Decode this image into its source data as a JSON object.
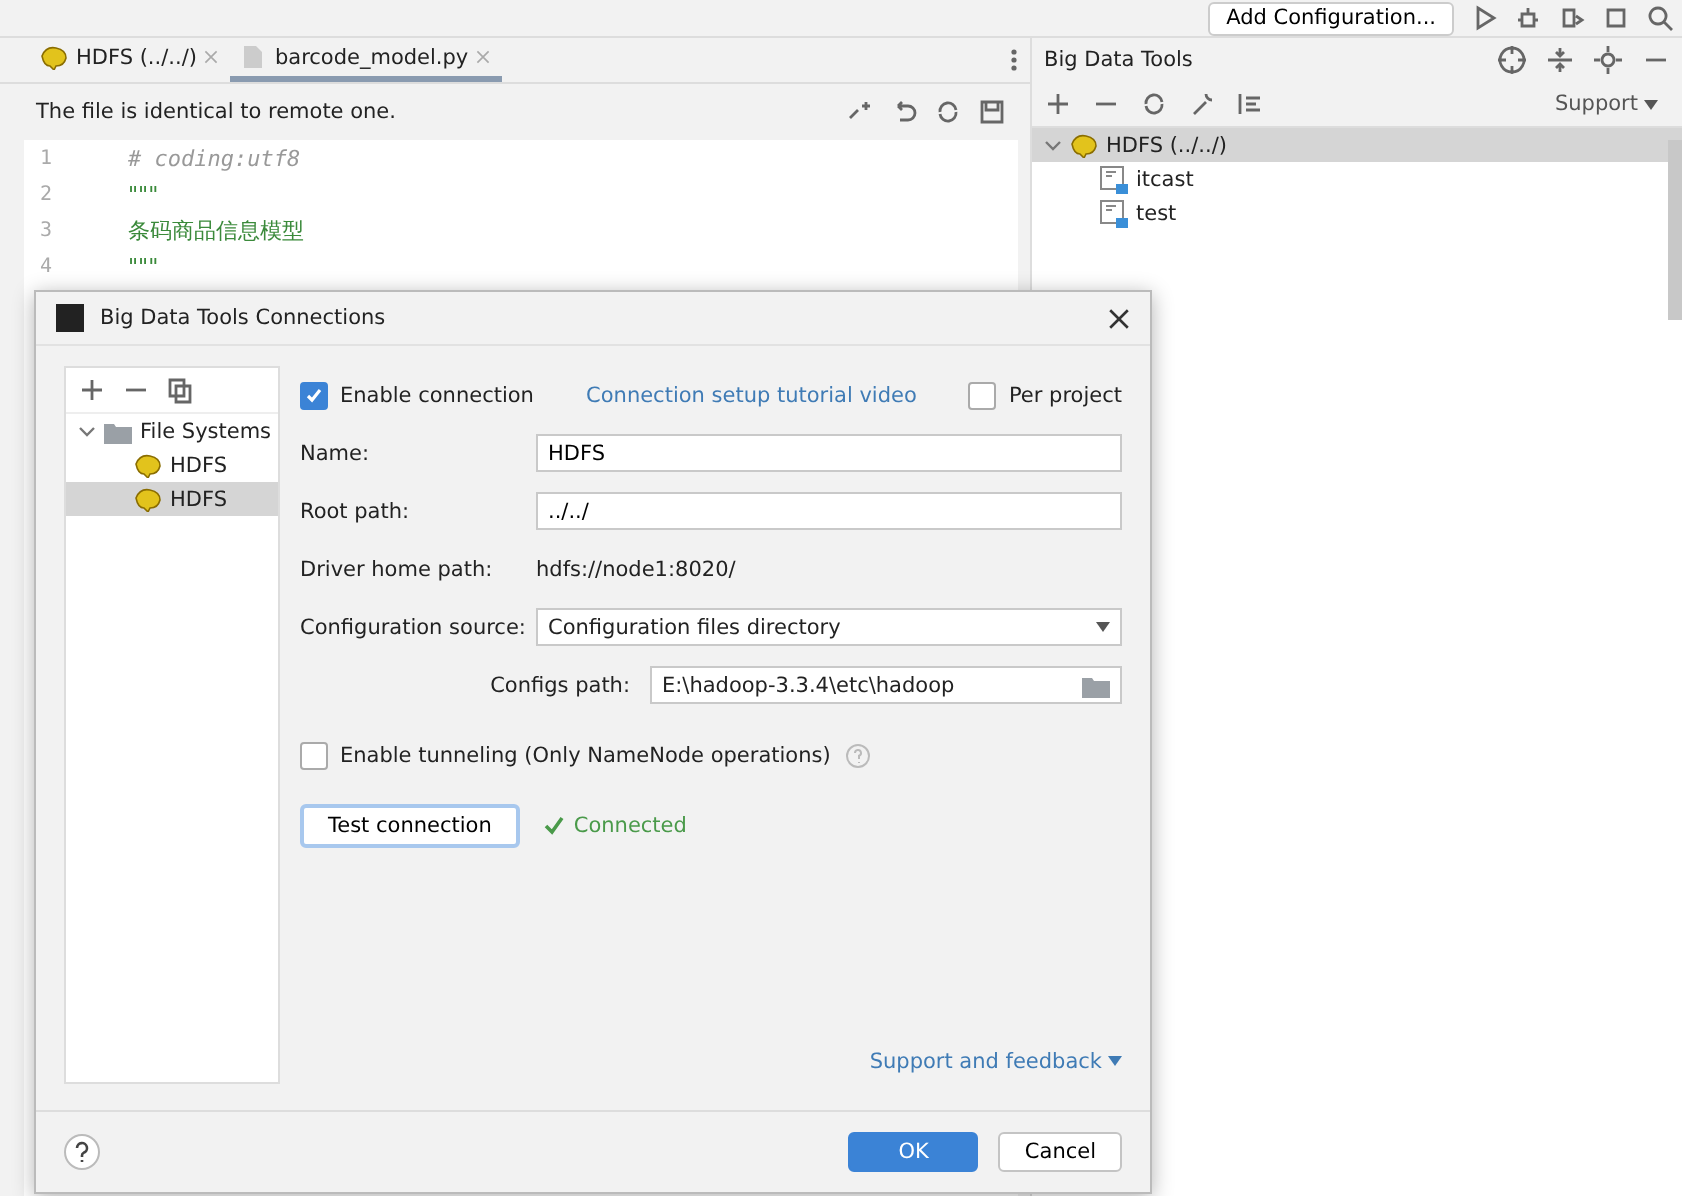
{
  "toolbar": {
    "config_button": "Add Configuration..."
  },
  "editor": {
    "tabs": [
      {
        "label": "HDFS (../../)",
        "kind": "hdfs",
        "selected": false
      },
      {
        "label": "barcode_model.py",
        "kind": "python",
        "selected": true
      }
    ],
    "notice": "The file is identical to remote one.",
    "lines": [
      {
        "number": "1",
        "text": "# coding:utf8",
        "kind": "comment"
      },
      {
        "number": "2",
        "text": "\"\"\"",
        "kind": "string"
      },
      {
        "number": "3",
        "text": "条码商品信息模型",
        "kind": "string"
      },
      {
        "number": "4",
        "text": "\"\"\"",
        "kind": "string"
      }
    ]
  },
  "side_panel": {
    "title": "Big Data Tools",
    "support": "Support",
    "tree": [
      {
        "label": "HDFS (../../)",
        "expanded": true,
        "selected": true,
        "children": [
          {
            "label": "itcast"
          },
          {
            "label": "test"
          }
        ]
      }
    ]
  },
  "dialog": {
    "title": "Big Data Tools Connections",
    "tree": [
      {
        "label": "File Systems",
        "expanded": true,
        "children": [
          {
            "label": "HDFS",
            "selected": false
          },
          {
            "label": "HDFS",
            "selected": true
          }
        ]
      }
    ],
    "enable_connection": {
      "label": "Enable connection",
      "checked": true
    },
    "tutorial_link": "Connection setup tutorial video",
    "per_project": {
      "label": "Per project",
      "checked": false
    },
    "name": {
      "label": "Name:",
      "value": "HDFS"
    },
    "root_path": {
      "label": "Root path:",
      "value": "../../"
    },
    "driver_home": {
      "label": "Driver home path:",
      "value": "hdfs://node1:8020/"
    },
    "config_source": {
      "label": "Configuration source:",
      "value": "Configuration files directory"
    },
    "configs_path": {
      "label": "Configs path:",
      "value": "E:\\hadoop-3.3.4\\etc\\hadoop"
    },
    "tunneling": {
      "label": "Enable tunneling (Only NameNode operations)",
      "checked": false
    },
    "test_button": "Test connection",
    "status": "Connected",
    "support_link": "Support and feedback",
    "ok": "OK",
    "cancel": "Cancel"
  }
}
